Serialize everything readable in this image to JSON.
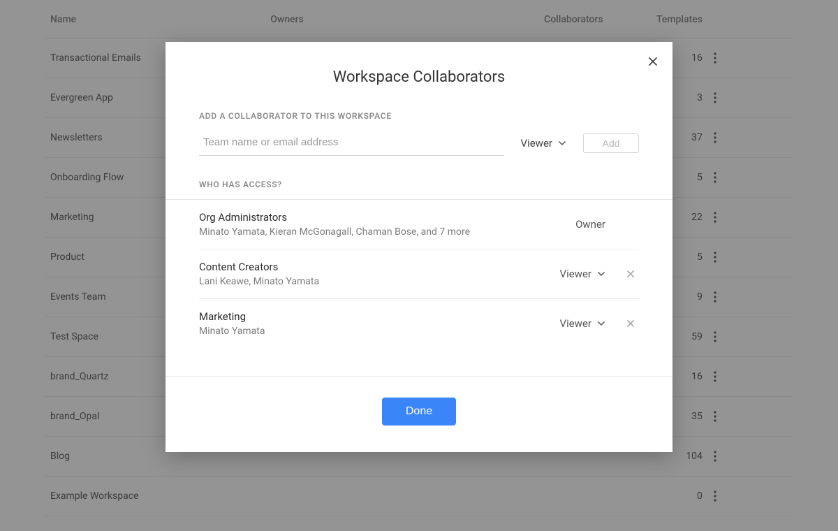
{
  "table": {
    "headers": {
      "name": "Name",
      "owners": "Owners",
      "collaborators": "Collaborators",
      "templates": "Templates"
    },
    "rows": [
      {
        "name": "Transactional Emails",
        "templates": 16
      },
      {
        "name": "Evergreen App",
        "templates": 3
      },
      {
        "name": "Newsletters",
        "templates": 37
      },
      {
        "name": "Onboarding Flow",
        "templates": 5
      },
      {
        "name": "Marketing",
        "templates": 22
      },
      {
        "name": "Product",
        "templates": 5
      },
      {
        "name": "Events Team",
        "templates": 9
      },
      {
        "name": "Test Space",
        "templates": 59
      },
      {
        "name": "brand_Quartz",
        "templates": 16
      },
      {
        "name": "brand_Opal",
        "templates": 35
      },
      {
        "name": "Blog",
        "templates": 104
      },
      {
        "name": "Example Workspace",
        "templates": 0
      }
    ]
  },
  "modal": {
    "title": "Workspace Collaborators",
    "add": {
      "section_label": "ADD A COLLABORATOR TO THIS WORKSPACE",
      "placeholder": "Team name or email address",
      "role_selected": "Viewer",
      "add_button": "Add"
    },
    "access": {
      "section_label": "WHO HAS ACCESS?",
      "entries": [
        {
          "name": "Org Administrators",
          "members": "Minato Yamata, Kieran McGonagall, Chaman Bose, and 7 more",
          "role": "Owner",
          "editable": false,
          "removable": false
        },
        {
          "name": "Content Creators",
          "members": "Lani Keawe, Minato Yamata",
          "role": "Viewer",
          "editable": true,
          "removable": true
        },
        {
          "name": "Marketing",
          "members": "Minato Yamata",
          "role": "Viewer",
          "editable": true,
          "removable": true
        }
      ]
    },
    "done_button": "Done"
  }
}
